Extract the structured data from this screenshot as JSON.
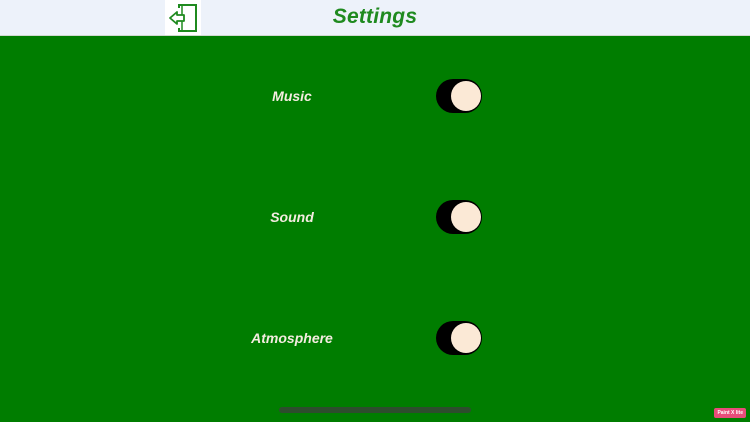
{
  "header": {
    "title": "Settings",
    "back_icon": "exit-door-arrow-icon"
  },
  "settings": [
    {
      "label": "Music",
      "state": "on"
    },
    {
      "label": "Sound",
      "state": "on"
    },
    {
      "label": "Atmosphere",
      "state": "on"
    }
  ],
  "badge": {
    "text": "Paint X lite"
  },
  "colors": {
    "background": "#007d00",
    "header": "#edf2fa",
    "title": "#1f8a1f",
    "toggle_track": "#000000",
    "toggle_knob": "#fbe9d6",
    "label": "#f4ece0"
  }
}
